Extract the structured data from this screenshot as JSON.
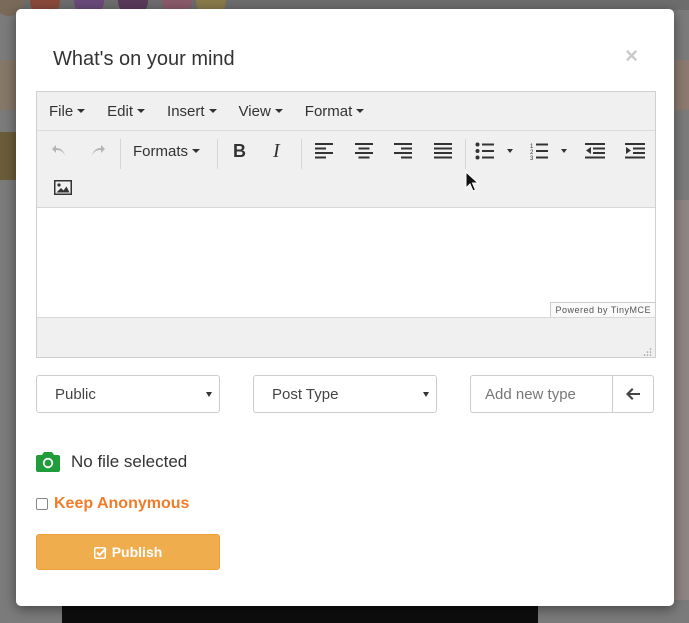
{
  "modal": {
    "title": "What's on your mind",
    "close_symbol": "×"
  },
  "editor": {
    "menu": [
      {
        "label": "File"
      },
      {
        "label": "Edit"
      },
      {
        "label": "Insert"
      },
      {
        "label": "View"
      },
      {
        "label": "Format"
      }
    ],
    "formats_label": "Formats",
    "powered_by": "Powered by TinyMCE",
    "toolbar_icons": [
      "undo-icon",
      "redo-icon",
      "bold-icon",
      "italic-icon",
      "align-left-icon",
      "align-center-icon",
      "align-right-icon",
      "align-justify-icon",
      "bullet-list-icon",
      "numbered-list-icon",
      "outdent-icon",
      "indent-icon",
      "image-icon"
    ]
  },
  "controls": {
    "visibility_select": "Public",
    "post_type_select": "Post Type",
    "new_type_placeholder": "Add new type"
  },
  "file": {
    "status": "No file selected",
    "icon": "camera-icon",
    "icon_color": "#1f9d3a"
  },
  "anonymous": {
    "label": "Keep Anonymous",
    "checked": false,
    "color": "#f07c29"
  },
  "publish": {
    "label": "Publish",
    "color": "#f0ad4e"
  }
}
